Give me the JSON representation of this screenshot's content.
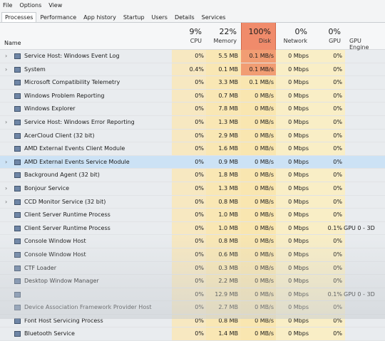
{
  "menu": [
    "File",
    "Options",
    "View"
  ],
  "tabs": [
    {
      "label": "Processes",
      "active": true
    },
    {
      "label": "Performance",
      "active": false
    },
    {
      "label": "App history",
      "active": false
    },
    {
      "label": "Startup",
      "active": false
    },
    {
      "label": "Users",
      "active": false
    },
    {
      "label": "Details",
      "active": false
    },
    {
      "label": "Services",
      "active": false
    }
  ],
  "header": {
    "name_label": "Name",
    "sort_indicator": "^",
    "cpu": {
      "pct": "9%",
      "label": "CPU"
    },
    "memory": {
      "pct": "22%",
      "label": "Memory"
    },
    "disk": {
      "pct": "100%",
      "label": "Disk"
    },
    "network": {
      "pct": "0%",
      "label": "Network"
    },
    "gpu": {
      "pct": "0%",
      "label": "GPU"
    },
    "gpu_engine": {
      "label": "GPU Engine"
    }
  },
  "colors": {
    "disk_hot": "#f19d73",
    "usage_light": "#f9e7b4",
    "selected_row": "#cce2f5"
  },
  "processes": [
    {
      "name": "Service Host: Windows Event Log",
      "expandable": true,
      "cpu": "0%",
      "memory": "5.5 MB",
      "disk": "0.1 MB/s",
      "network": "0 Mbps",
      "gpu": "0%",
      "engine": "",
      "disk_hot": true
    },
    {
      "name": "System",
      "expandable": true,
      "cpu": "0.4%",
      "memory": "0.1 MB",
      "disk": "0.1 MB/s",
      "network": "0 Mbps",
      "gpu": "0%",
      "engine": "",
      "disk_hot": true
    },
    {
      "name": "Microsoft Compatibility Telemetry",
      "expandable": false,
      "cpu": "0%",
      "memory": "3.3 MB",
      "disk": "0.1 MB/s",
      "network": "0 Mbps",
      "gpu": "0%",
      "engine": "",
      "disk_hot": false
    },
    {
      "name": "Windows Problem Reporting",
      "expandable": false,
      "cpu": "0%",
      "memory": "0.7 MB",
      "disk": "0 MB/s",
      "network": "0 Mbps",
      "gpu": "0%",
      "engine": "",
      "disk_hot": false
    },
    {
      "name": "Windows Explorer",
      "expandable": false,
      "cpu": "0%",
      "memory": "7.8 MB",
      "disk": "0 MB/s",
      "network": "0 Mbps",
      "gpu": "0%",
      "engine": "",
      "disk_hot": false
    },
    {
      "name": "Service Host: Windows Error Reporting",
      "expandable": true,
      "cpu": "0%",
      "memory": "1.3 MB",
      "disk": "0 MB/s",
      "network": "0 Mbps",
      "gpu": "0%",
      "engine": "",
      "disk_hot": false
    },
    {
      "name": "AcerCloud Client (32 bit)",
      "expandable": false,
      "cpu": "0%",
      "memory": "2.9 MB",
      "disk": "0 MB/s",
      "network": "0 Mbps",
      "gpu": "0%",
      "engine": "",
      "disk_hot": false
    },
    {
      "name": "AMD External Events Client Module",
      "expandable": false,
      "cpu": "0%",
      "memory": "1.6 MB",
      "disk": "0 MB/s",
      "network": "0 Mbps",
      "gpu": "0%",
      "engine": "",
      "disk_hot": false
    },
    {
      "name": "AMD External Events Service Module",
      "expandable": true,
      "cpu": "0%",
      "memory": "0.9 MB",
      "disk": "0 MB/s",
      "network": "0 Mbps",
      "gpu": "0%",
      "engine": "",
      "disk_hot": false,
      "selected": true
    },
    {
      "name": "Background Agent (32 bit)",
      "expandable": false,
      "cpu": "0%",
      "memory": "1.8 MB",
      "disk": "0 MB/s",
      "network": "0 Mbps",
      "gpu": "0%",
      "engine": "",
      "disk_hot": false
    },
    {
      "name": "Bonjour Service",
      "expandable": true,
      "cpu": "0%",
      "memory": "1.3 MB",
      "disk": "0 MB/s",
      "network": "0 Mbps",
      "gpu": "0%",
      "engine": "",
      "disk_hot": false
    },
    {
      "name": "CCD Monitor Service (32 bit)",
      "expandable": true,
      "cpu": "0%",
      "memory": "0.8 MB",
      "disk": "0 MB/s",
      "network": "0 Mbps",
      "gpu": "0%",
      "engine": "",
      "disk_hot": false
    },
    {
      "name": "Client Server Runtime Process",
      "expandable": false,
      "cpu": "0%",
      "memory": "1.0 MB",
      "disk": "0 MB/s",
      "network": "0 Mbps",
      "gpu": "0%",
      "engine": "",
      "disk_hot": false
    },
    {
      "name": "Client Server Runtime Process",
      "expandable": false,
      "cpu": "0%",
      "memory": "1.0 MB",
      "disk": "0 MB/s",
      "network": "0 Mbps",
      "gpu": "0.1%",
      "engine": "GPU 0 - 3D",
      "disk_hot": false
    },
    {
      "name": "Console Window Host",
      "expandable": false,
      "cpu": "0%",
      "memory": "0.8 MB",
      "disk": "0 MB/s",
      "network": "0 Mbps",
      "gpu": "0%",
      "engine": "",
      "disk_hot": false
    },
    {
      "name": "Console Window Host",
      "expandable": false,
      "cpu": "0%",
      "memory": "0.6 MB",
      "disk": "0 MB/s",
      "network": "0 Mbps",
      "gpu": "0%",
      "engine": "",
      "disk_hot": false
    },
    {
      "name": "CTF Loader",
      "expandable": false,
      "cpu": "0%",
      "memory": "0.3 MB",
      "disk": "0 MB/s",
      "network": "0 Mbps",
      "gpu": "0%",
      "engine": "",
      "disk_hot": false
    },
    {
      "name": "Desktop Window Manager",
      "expandable": false,
      "cpu": "0%",
      "memory": "2.2 MB",
      "disk": "0 MB/s",
      "network": "0 Mbps",
      "gpu": "0%",
      "engine": "",
      "disk_hot": false
    },
    {
      "name": "",
      "expandable": false,
      "cpu": "0%",
      "memory": "12.9 MB",
      "disk": "0 MB/s",
      "network": "0 Mbps",
      "gpu": "0.1%",
      "engine": "GPU 0 - 3D",
      "disk_hot": false
    },
    {
      "name": "Device Association Framework Provider Host",
      "expandable": false,
      "cpu": "0%",
      "memory": "2.7 MB",
      "disk": "0 MB/s",
      "network": "0 Mbps",
      "gpu": "0%",
      "engine": "",
      "disk_hot": false
    },
    {
      "name": "Font Host Servicing Process",
      "expandable": false,
      "cpu": "0%",
      "memory": "0.8 MB",
      "disk": "0 MB/s",
      "network": "0 Mbps",
      "gpu": "0%",
      "engine": "",
      "disk_hot": false
    },
    {
      "name": "Bluetooth Service",
      "expandable": false,
      "cpu": "0%",
      "memory": "1.4 MB",
      "disk": "0 MB/s",
      "network": "0 Mbps",
      "gpu": "0%",
      "engine": "",
      "disk_hot": false
    }
  ]
}
